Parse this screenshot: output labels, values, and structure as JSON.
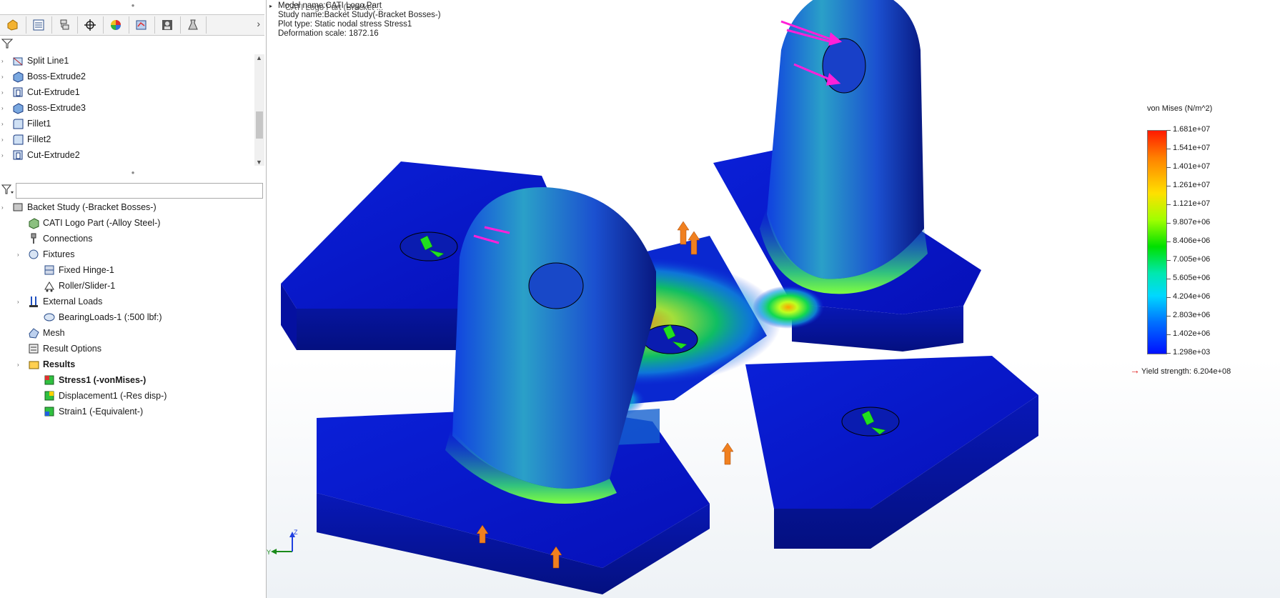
{
  "feature_tree": {
    "items": [
      {
        "label": "Split Line1",
        "icon": "split-line-icon"
      },
      {
        "label": "Boss-Extrude2",
        "icon": "boss-extrude-icon"
      },
      {
        "label": "Cut-Extrude1",
        "icon": "cut-extrude-icon"
      },
      {
        "label": "Boss-Extrude3",
        "icon": "boss-extrude-icon"
      },
      {
        "label": "Fillet1",
        "icon": "fillet-icon"
      },
      {
        "label": "Fillet2",
        "icon": "fillet-icon"
      },
      {
        "label": "Cut-Extrude2",
        "icon": "cut-extrude-icon"
      }
    ]
  },
  "study_tree": {
    "items": [
      {
        "label": "Backet Study (-Bracket Bosses-)",
        "icon": "study-icon"
      },
      {
        "label": "CATI Logo Part (-Alloy Steel-)",
        "icon": "part-icon"
      },
      {
        "label": "Connections",
        "icon": "connections-icon"
      },
      {
        "label": "Fixtures",
        "icon": "fixtures-icon"
      },
      {
        "label": "Fixed Hinge-1",
        "icon": "fixed-hinge-icon"
      },
      {
        "label": "Roller/Slider-1",
        "icon": "roller-slider-icon"
      },
      {
        "label": "External Loads",
        "icon": "external-loads-icon"
      },
      {
        "label": "BearingLoads-1 (:500 lbf:)",
        "icon": "bearing-load-icon"
      },
      {
        "label": "Mesh",
        "icon": "mesh-icon"
      },
      {
        "label": "Result Options",
        "icon": "result-options-icon"
      },
      {
        "label": "Results",
        "icon": "results-folder-icon"
      },
      {
        "label": "Stress1 (-vonMises-)",
        "icon": "stress-plot-icon"
      },
      {
        "label": "Displacement1 (-Res disp-)",
        "icon": "displacement-plot-icon"
      },
      {
        "label": "Strain1 (-Equivalent-)",
        "icon": "strain-plot-icon"
      }
    ]
  },
  "viewport": {
    "info": {
      "model_name": "Model name:CATI Logo Part",
      "study_name": "Study name:Backet Study(-Bracket Bosses-)",
      "plot_type": "Plot type: Static nodal stress Stress1",
      "deformation": "Deformation scale: 1872.16",
      "breadcrumb": "CATI Logo Part (Bracket ..."
    },
    "legend": {
      "title": "von Mises (N/m^2)",
      "labels": [
        "1.681e+07",
        "1.541e+07",
        "1.401e+07",
        "1.261e+07",
        "1.121e+07",
        "9.807e+06",
        "8.406e+06",
        "7.005e+06",
        "5.605e+06",
        "4.204e+06",
        "2.803e+06",
        "1.402e+06",
        "1.298e+03"
      ],
      "yield": "Yield strength: 6.204e+08"
    },
    "triad": {
      "y": "Y",
      "z": "Z"
    }
  }
}
